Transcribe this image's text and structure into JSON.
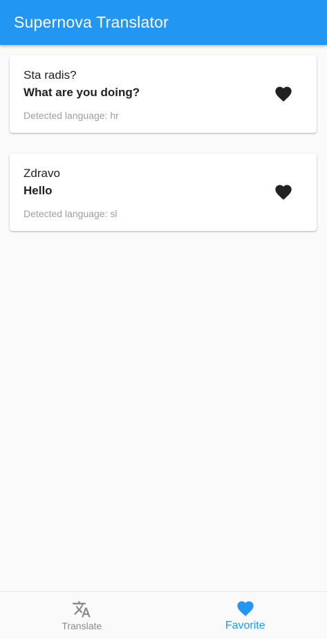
{
  "app_bar": {
    "title": "Supernova Translator",
    "color": "#2196f3"
  },
  "favorites": [
    {
      "source": "Sta radis?",
      "translation": "What are you doing?",
      "detected_language": "Detected language: hr",
      "icon": "heart-icon"
    },
    {
      "source": "Zdravo",
      "translation": "Hello",
      "detected_language": "Detected language: sl",
      "icon": "heart-icon"
    }
  ],
  "bottom_nav": {
    "items": [
      {
        "label": "Translate",
        "icon": "translate-icon",
        "active": false
      },
      {
        "label": "Favorite",
        "icon": "heart-icon",
        "active": true
      }
    ],
    "active_color": "#2196f3",
    "inactive_color": "#8a8a8a"
  }
}
